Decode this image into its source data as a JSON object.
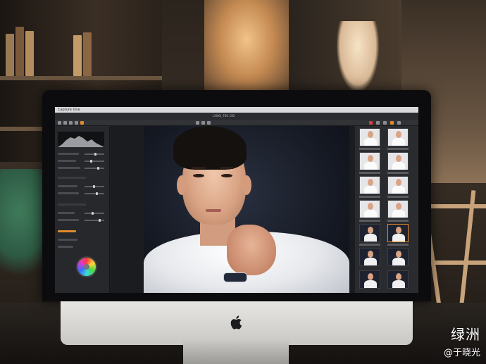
{
  "menubar": {
    "app_name": "Capture One"
  },
  "document": {
    "title": "LXXXX_F69.CR2"
  },
  "viewer": {
    "subject": "portrait-photo"
  },
  "colors": {
    "accent_selected": "#e08a2b",
    "chin": "#e0dfdc",
    "bezel": "#0c0c0e"
  },
  "watermark": {
    "logo_text": "绿洲",
    "username": "@于晓光"
  }
}
